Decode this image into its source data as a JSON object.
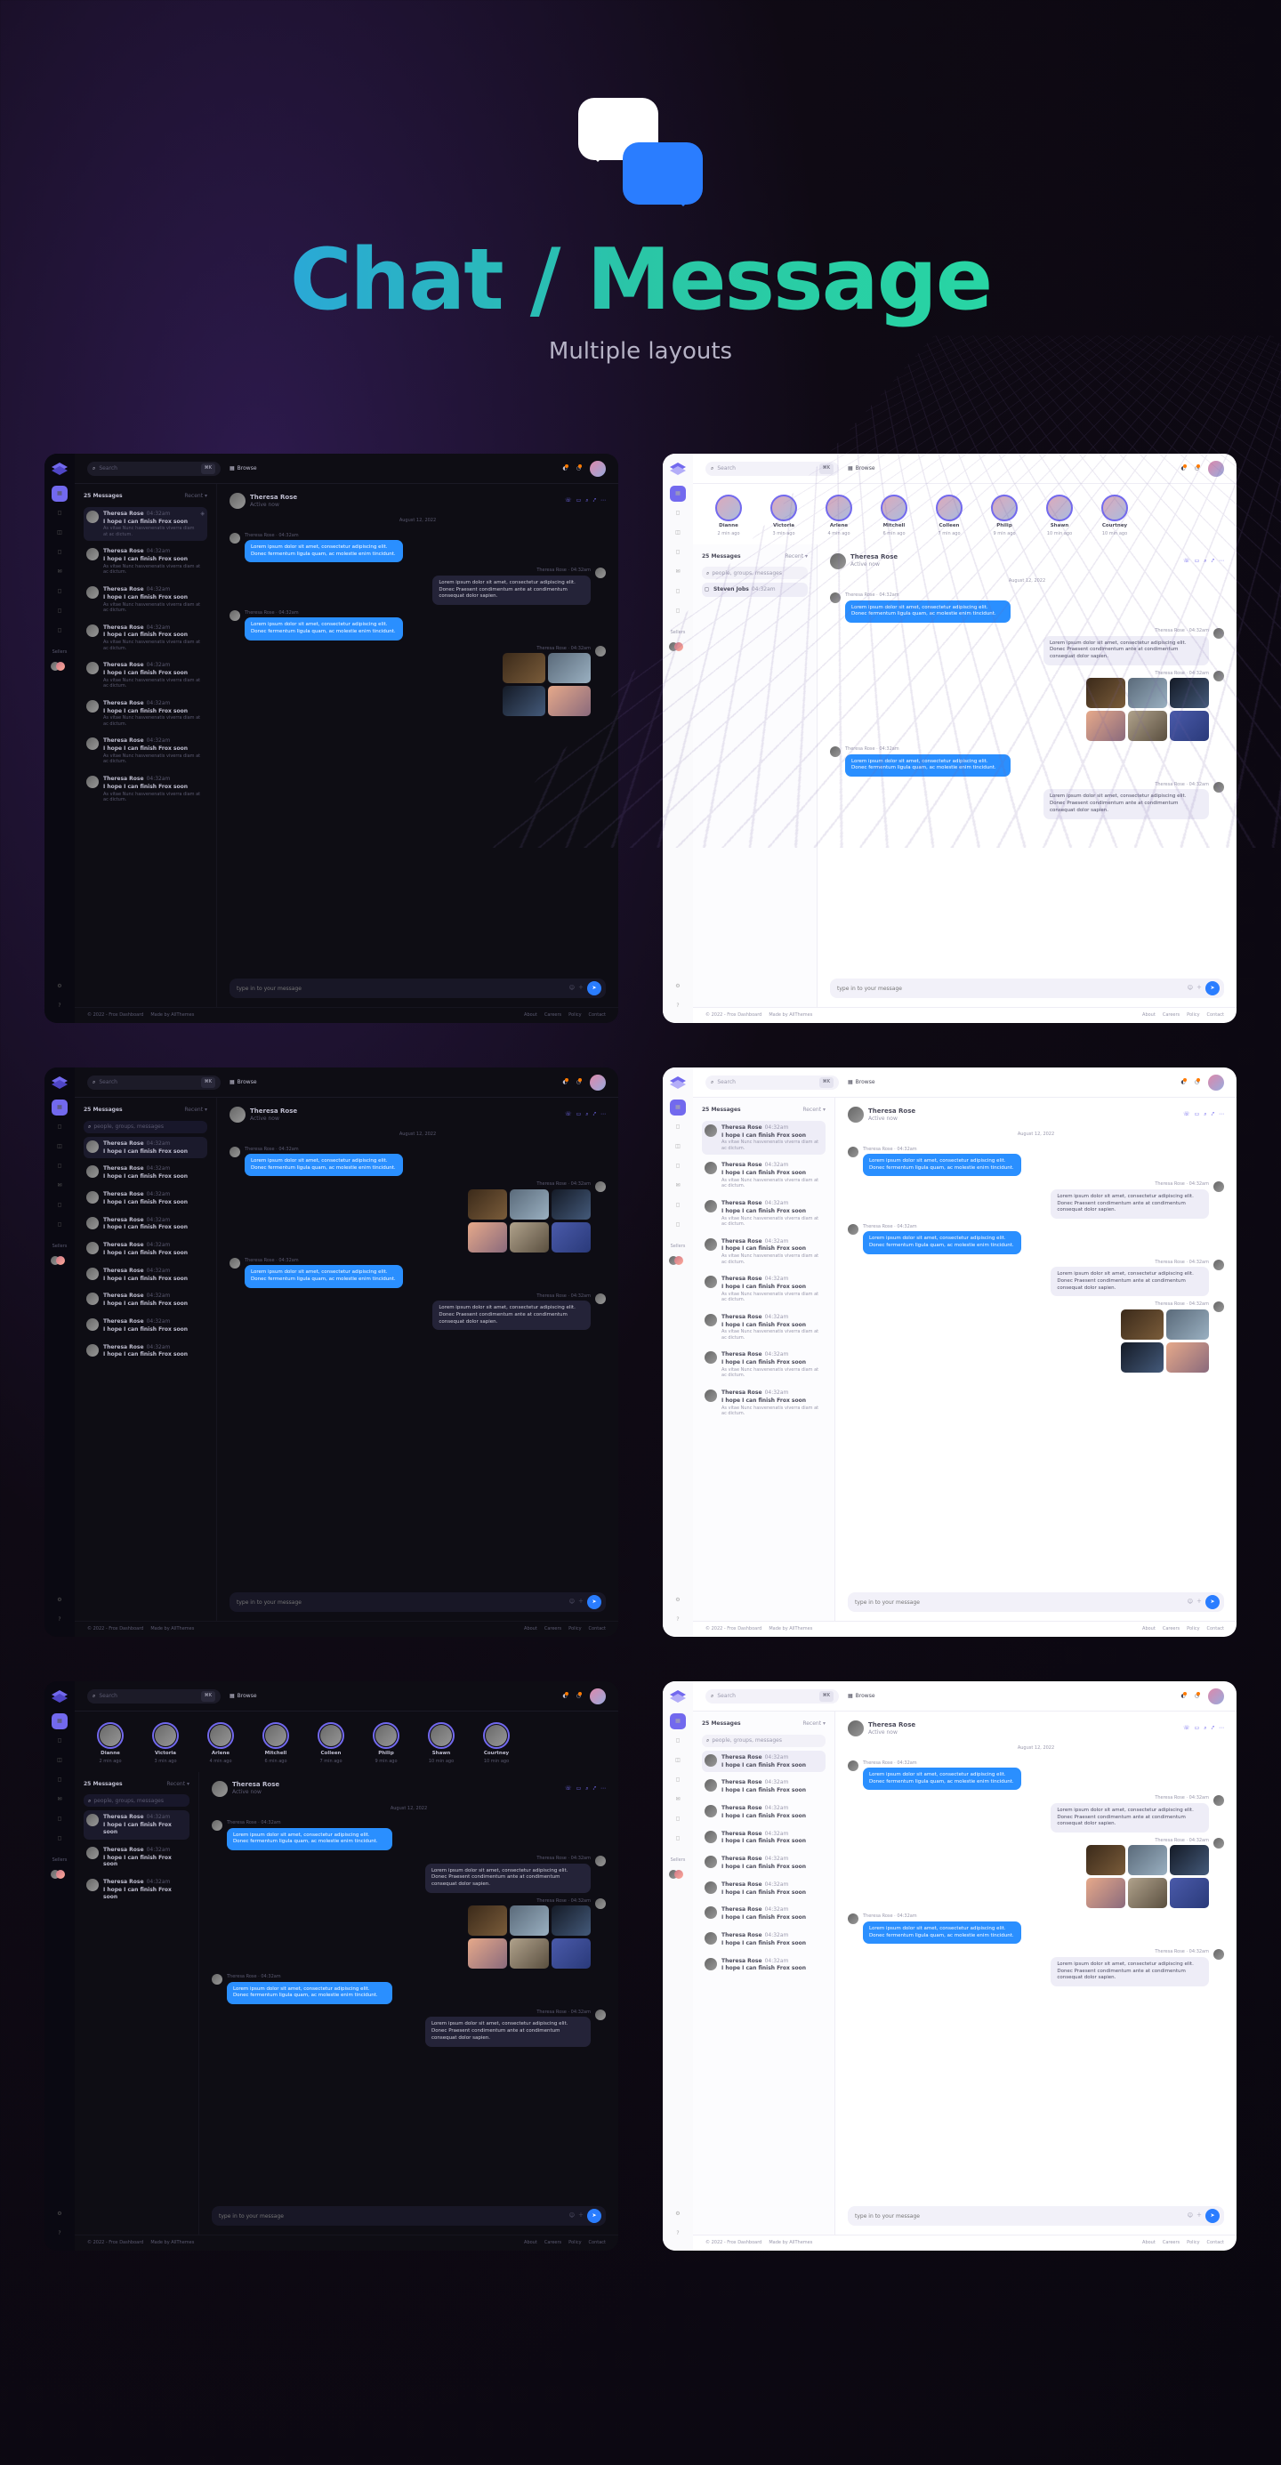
{
  "hero": {
    "title": "Chat / Message",
    "subtitle": "Multiple layouts"
  },
  "search": {
    "placeholder": "Search",
    "cmd": "⌘K"
  },
  "browse": "Browse",
  "sidebarLabel": "Sellers",
  "messagesTitle": "25 Messages",
  "recent": "Recent",
  "mini_search_placeholder": "people, groups, messages",
  "list_item": {
    "name": "Theresa Rose",
    "time": "04:32am",
    "hopeline": "I hope I can finish Frox soon",
    "sub": "As vitae Nunc hasvenenatis viverra diam at ac dictum."
  },
  "list_special": {
    "badge": "◻",
    "name": "Steven Jobs",
    "time": "04:32am"
  },
  "chat": {
    "name": "Theresa Rose",
    "status": "Active now",
    "date": "August 12, 2022",
    "meta_left": "Theresa Rose · 04:32am",
    "meta_right": "Theresa Rose · 04:32am",
    "msg_blue": "Lorem ipsum dolor sit amet, consectetur adipiscing elit. Donec fermentum ligula quam, ac molestie enim tincidunt.",
    "msg_gray": "Lorem ipsum dolor sit amet, consectetur adipiscing elit. Donec Praesent condimentum ante at condimentum consequat dolor sapien.",
    "composer": "type in to your message"
  },
  "stories": [
    {
      "name": "Dianne",
      "time": "2 min ago"
    },
    {
      "name": "Victoria",
      "time": "3 min ago"
    },
    {
      "name": "Arlene",
      "time": "4 min ago"
    },
    {
      "name": "Mitchell",
      "time": "6 min ago"
    },
    {
      "name": "Colleen",
      "time": "7 min ago"
    },
    {
      "name": "Philip",
      "time": "9 min ago"
    },
    {
      "name": "Shawn",
      "time": "10 min ago"
    },
    {
      "name": "Courtney",
      "time": "10 min ago"
    }
  ],
  "footer": {
    "copy": "© 2022 - Frox Dashboard",
    "made": "Made by AllThemes",
    "links": [
      "About",
      "Careers",
      "Policy",
      "Contact"
    ]
  }
}
